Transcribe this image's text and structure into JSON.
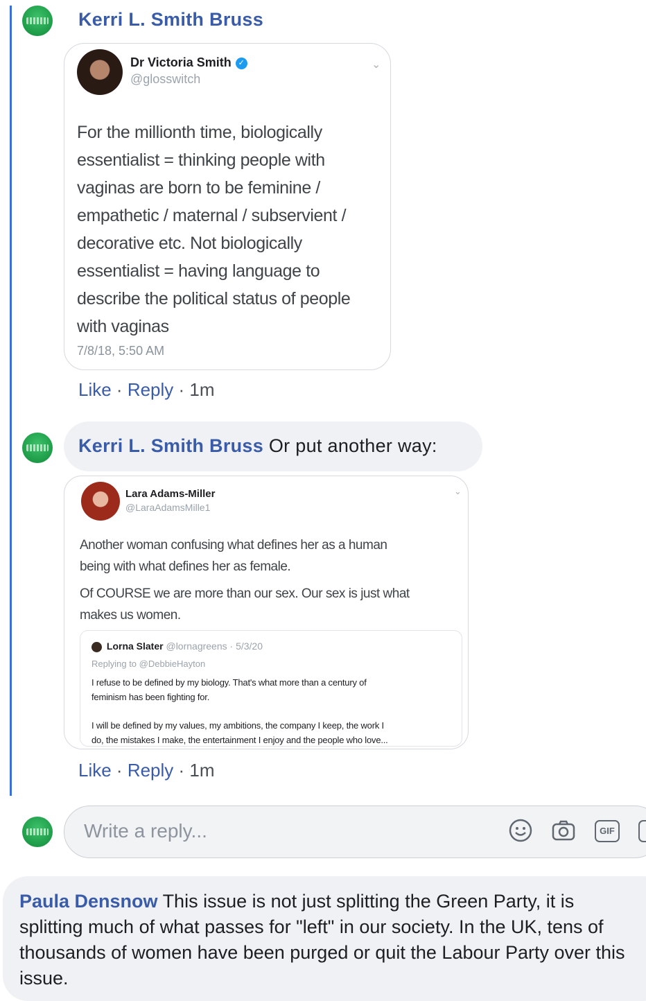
{
  "comments": [
    {
      "author": "Kerri L. Smith Bruss",
      "text": "",
      "tweet": {
        "name": "Dr Victoria Smith",
        "handle": "@glosswitch",
        "lines": [
          "For the millionth time, biologically",
          "essentialist = thinking people with",
          "vaginas are born to be feminine /",
          "empathetic / maternal / subservient /",
          "decorative etc. Not biologically",
          "essentialist = having language to",
          "describe the political status of people",
          "with vaginas"
        ],
        "timestamp": "7/8/18, 5:50 AM"
      },
      "actions": {
        "like": "Like",
        "sep": " · ",
        "reply": "Reply",
        "time": "1m"
      }
    },
    {
      "author": "Kerri L. Smith Bruss",
      "text": "Or put another way:",
      "tweet": {
        "name": "Lara Adams-Miller",
        "handle": "@LaraAdamsMille1",
        "paragraphs": [
          [
            "Another woman confusing what defines her as a human",
            "being with what defines her as female."
          ],
          [
            "Of COURSE we are more than our sex. Our sex is just what",
            "makes us women."
          ]
        ],
        "quote": {
          "name": "Lorna Slater",
          "meta": "@lornagreens · 5/3/20",
          "replying": "Replying to @DebbieHayton",
          "lines1": [
            "I refuse to be defined by my biology. That's what more than a century of",
            "feminism has been fighting for."
          ],
          "lines2": [
            "I will be defined by my values, my ambitions, the company I keep, the work I",
            "do, the mistakes I make, the entertainment I enjoy and the people who love..."
          ]
        }
      },
      "actions": {
        "like": "Like",
        "sep": " · ",
        "reply": "Reply",
        "time": "1m"
      }
    }
  ],
  "reply_box": {
    "placeholder": "Write a reply...",
    "icons": [
      "emoji-icon",
      "camera-icon",
      "gif-icon",
      "sticker-icon"
    ],
    "gif_label": "GIF"
  },
  "bottom_comment": {
    "author": "Paula Densnow",
    "text": "This issue is not just splitting the Green Party, it is splitting much of what passes for \"left\" in our society. In the UK, tens of thousands of women have been purged or quit the Labour Party over this issue."
  },
  "colors": {
    "link": "#3a5ca8",
    "thread_line": "#3b6fe0",
    "bubble": "#eff1f4"
  }
}
